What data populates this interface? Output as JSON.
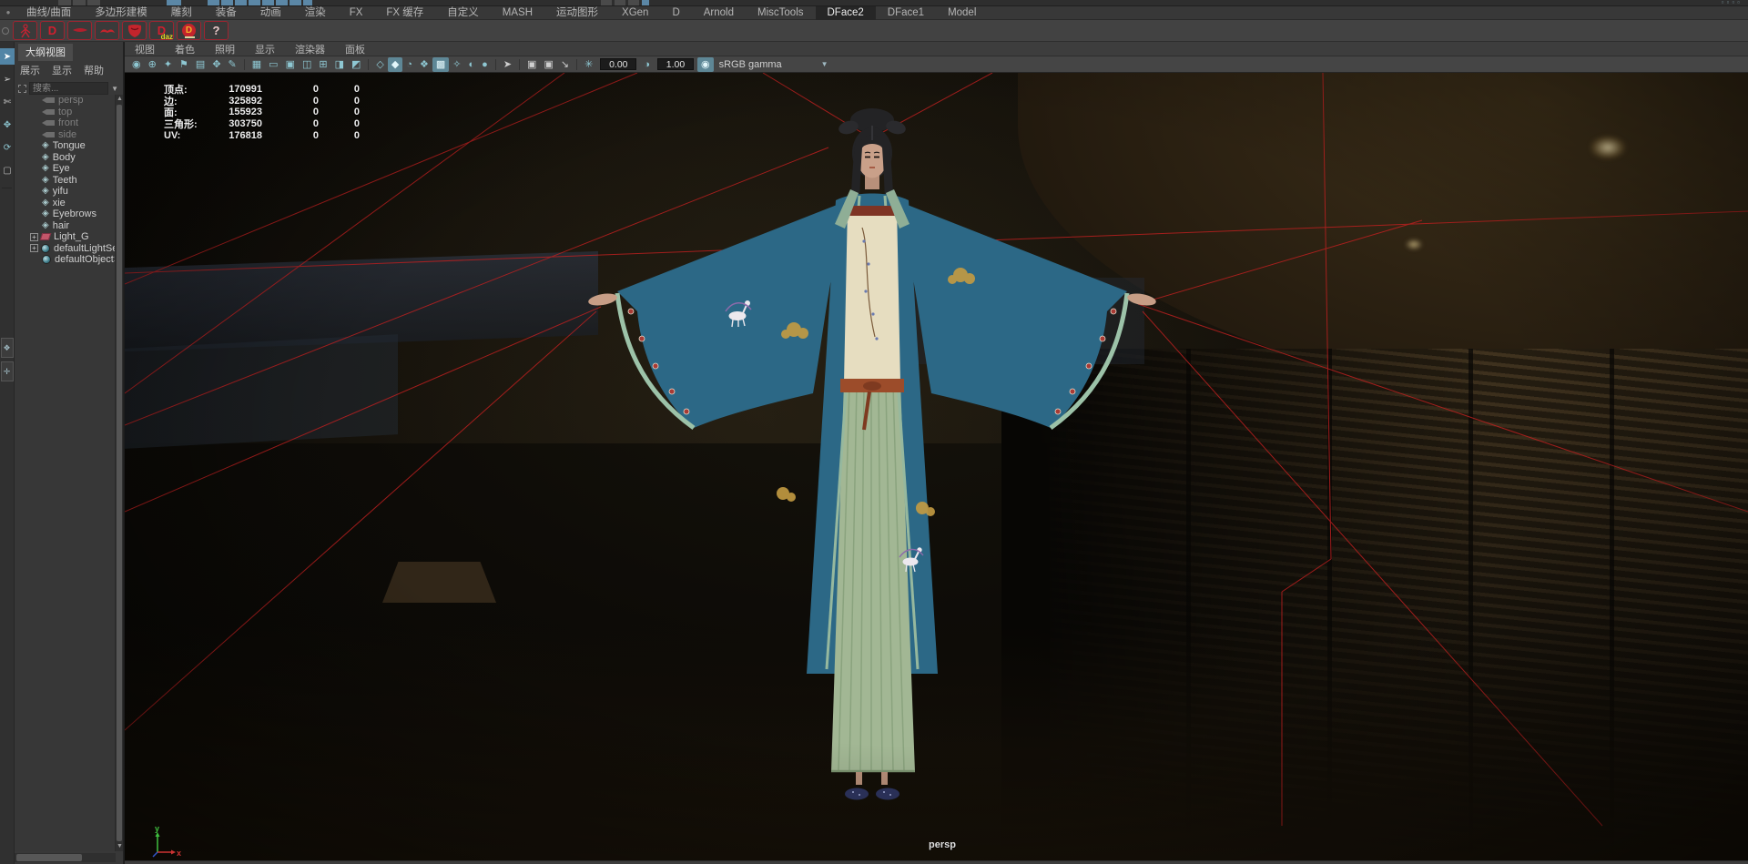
{
  "topbar": {
    "menus": [
      "曲线/曲面",
      "多边形建模",
      "雕刻",
      "装备",
      "动画",
      "渲染",
      "FX",
      "FX 缓存",
      "自定义",
      "MASH",
      "运动图形",
      "XGen",
      "D",
      "Arnold",
      "MiscTools",
      "DFace2",
      "DFace1",
      "Model"
    ],
    "active_menu": "DFace2"
  },
  "shelf": {
    "d_label": "D",
    "daz_label": "daz",
    "badge_label": "D",
    "help_label": "?"
  },
  "outliner": {
    "tab": "大纲视图",
    "menus": [
      "展示",
      "显示",
      "帮助"
    ],
    "search_placeholder": "搜索...",
    "items": [
      {
        "label": "persp"
      },
      {
        "label": "top"
      },
      {
        "label": "front"
      },
      {
        "label": "side"
      },
      {
        "label": "Tongue"
      },
      {
        "label": "Body"
      },
      {
        "label": "Eye"
      },
      {
        "label": "Teeth"
      },
      {
        "label": "yifu"
      },
      {
        "label": "xie"
      },
      {
        "label": "Eyebrows"
      },
      {
        "label": "hair"
      },
      {
        "label": "Light_G"
      },
      {
        "label": "defaultLightSet"
      },
      {
        "label": "defaultObjectSet"
      }
    ]
  },
  "viewport": {
    "menus": [
      "视图",
      "着色",
      "照明",
      "显示",
      "渲染器",
      "面板"
    ],
    "toolbar": {
      "exposure": "0.00",
      "gamma": "1.00",
      "color_space": "sRGB gamma"
    },
    "hud": {
      "rows": [
        {
          "label": "顶点:",
          "value": "170991",
          "a": "0",
          "b": "0"
        },
        {
          "label": "边:",
          "value": "325892",
          "a": "0",
          "b": "0"
        },
        {
          "label": "面:",
          "value": "155923",
          "a": "0",
          "b": "0"
        },
        {
          "label": "三角形:",
          "value": "303750",
          "a": "0",
          "b": "0"
        },
        {
          "label": "UV:",
          "value": "176818",
          "a": "0",
          "b": "0"
        }
      ]
    },
    "camera_label": "persp",
    "axis": {
      "x": "x",
      "y": "y"
    }
  },
  "colors": {
    "accent_teal": "#8ec7d2",
    "selection_blue": "#5285a6",
    "wire_red": "#c42020",
    "robe_blue": "#2c6886",
    "skirt_green": "#a2b794",
    "shelf_red": "#d21f2e"
  }
}
